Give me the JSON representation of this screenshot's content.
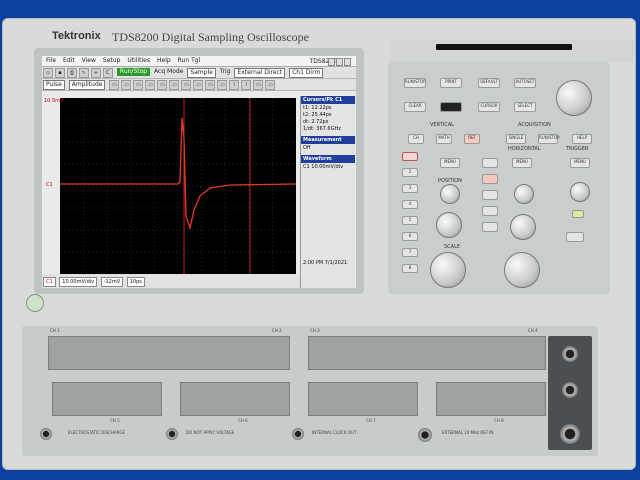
{
  "brand": "Tektronix",
  "model": "TDS8200 Digital Sampling Oscilloscope",
  "app_title": "TDS8200",
  "menubar": [
    "File",
    "Edit",
    "View",
    "Setup",
    "Utilities",
    "Help",
    "Run Tgl"
  ],
  "toolbar1": {
    "run_stop": "Run/Stop",
    "acq_mode_label": "Acq Mode",
    "acq_mode": "Sample",
    "trig_label": "Trig",
    "trig_source": "External Direct",
    "trig_level": "Ch1 Dirm"
  },
  "toolbar2": {
    "display_mode": "Pulse",
    "amplitude": "Amplitude"
  },
  "scope": {
    "ch_scale_label": "10.5mV",
    "ch_marker": "C1",
    "trig_marker": "T",
    "wfm_marker": "M",
    "bottom_ch": "C1",
    "bottom_scale": "10.00mV/div",
    "bottom_pos": "-12mV",
    "bottom_time": "10ps",
    "time_display": "2:00 PM  7/1/2021"
  },
  "side_panel": {
    "cursors_header": "Cursors/Pk C1",
    "cursor_rows": [
      "t1: 12.22ps",
      "t2: 25.44ps",
      "dt: 2.72ps",
      "1/dt: 367.6GHz"
    ],
    "meas_header": "Measurement",
    "meas_value": "Off",
    "wfm_header": "Waveform",
    "wfm_value": "C1 10.00mV/div"
  },
  "panel": {
    "vertical": "VERTICAL",
    "acquisition": "ACQUISITION",
    "horizontal": "HORIZONTAL",
    "trigger": "TRIGGER",
    "position": "POSITION",
    "scale": "SCALE",
    "buttons_top": [
      "RUN/STOP",
      "PRINT",
      "DEFAULT",
      "AUTOSET",
      "HELP"
    ],
    "buttons_row2": [
      "CLEAR",
      "",
      "CURSOR",
      "SELECT"
    ],
    "vert_btns": [
      "CH",
      "MATH",
      "REF"
    ],
    "ch_nums": [
      "1",
      "2",
      "3",
      "4",
      "5",
      "6",
      "7",
      "8"
    ],
    "menu": "MENU",
    "acq_btns": [
      "SINGLE",
      "RUN/STOP",
      "HELP"
    ]
  },
  "bay": {
    "top_left_labels": [
      "CH 1",
      "CH 2",
      "CH 3",
      "CH 4"
    ],
    "bottom_labels": [
      "CH 5",
      "CH 6",
      "CH 7",
      "CH 8"
    ],
    "notes": [
      "ELECTROSTATIC DISCHARGE",
      "DO NOT APPLY VOLTAGE",
      "INTERNAL CLOCK OUT",
      "EXTERNAL 10 MHz REF IN"
    ]
  }
}
